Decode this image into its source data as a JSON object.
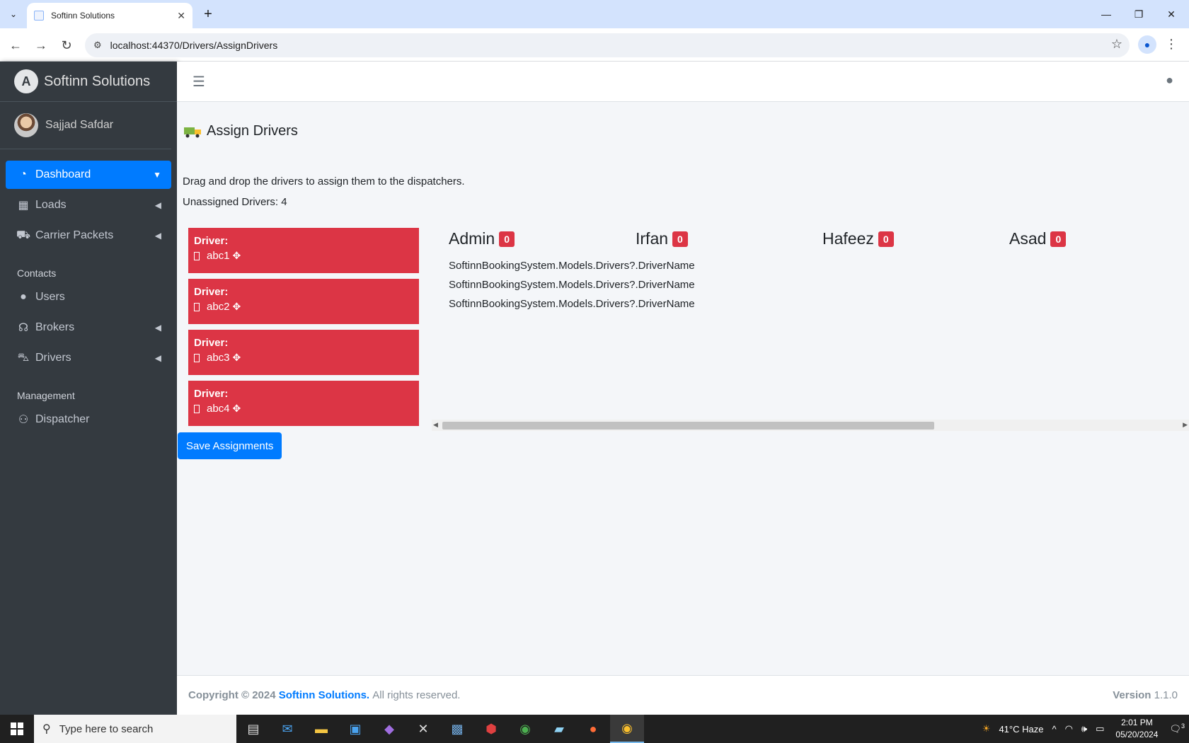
{
  "browser": {
    "tab_title": "Softinn Solutions",
    "url": "localhost:44370/Drivers/AssignDrivers"
  },
  "sidebar": {
    "brand": "Softinn Solutions",
    "user_name": "Sajjad Safdar",
    "items": [
      {
        "label": "Dashboard",
        "icon": "dashboard-icon"
      },
      {
        "label": "Loads",
        "icon": "loads-icon"
      },
      {
        "label": "Carrier Packets",
        "icon": "truck-icon"
      },
      {
        "label": "Users",
        "icon": "user-icon"
      },
      {
        "label": "Brokers",
        "icon": "headset-icon"
      },
      {
        "label": "Drivers",
        "icon": "car-icon"
      },
      {
        "label": "Dispatcher",
        "icon": "dispatcher-icon"
      }
    ],
    "headers": {
      "contacts": "Contacts",
      "management": "Management"
    }
  },
  "page": {
    "title": "Assign Drivers",
    "instructions": "Drag and drop the drivers to assign them to the dispatchers.",
    "unassigned": "Unassigned Drivers: 4",
    "driver_label": "Driver:",
    "drivers": [
      "abc1",
      "abc2",
      "abc3",
      "abc4"
    ],
    "dispatchers": [
      {
        "name": "Admin",
        "count": "0",
        "items": [
          "SoftinnBookingSystem.Models.Drivers?.DriverName",
          "SoftinnBookingSystem.Models.Drivers?.DriverName",
          "SoftinnBookingSystem.Models.Drivers?.DriverName"
        ]
      },
      {
        "name": "Irfan",
        "count": "0",
        "items": []
      },
      {
        "name": "Hafeez",
        "count": "0",
        "items": []
      },
      {
        "name": "Asad",
        "count": "0",
        "items": []
      }
    ],
    "save_label": "Save Assignments"
  },
  "footer": {
    "copyright": "Copyright © 2024",
    "brand": "Softinn Solutions.",
    "rights": "All rights reserved.",
    "version_label": "Version",
    "version": "1.1.0"
  },
  "taskbar": {
    "search_placeholder": "Type here to search",
    "weather": "41°C  Haze",
    "time": "2:01 PM",
    "date": "05/20/2024",
    "notifications": "3"
  },
  "colors": {
    "sidebar_bg": "#343a40",
    "accent": "#007bff",
    "driver_card": "#dc3545",
    "content_bg": "#f4f6f9"
  }
}
